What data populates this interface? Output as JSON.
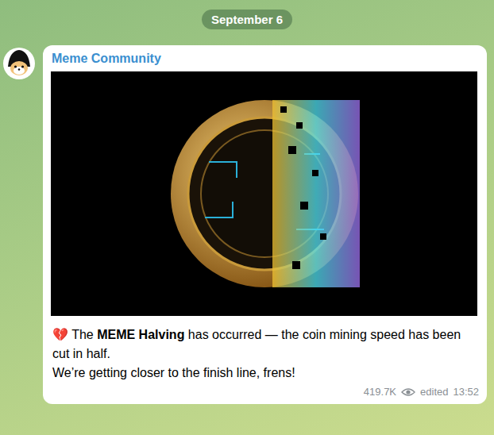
{
  "date": "September 6",
  "post": {
    "channel": "Meme Community",
    "paragraphs": [
      [
        {
          "text": "💔 The ",
          "bold": false
        },
        {
          "text": "MEME Halving",
          "bold": true
        },
        {
          "text": " has occurred — the coin mining speed has been cut in half.",
          "bold": false
        }
      ],
      [
        {
          "text": "We’re getting closer to the finish line, frens!",
          "bold": false
        }
      ]
    ],
    "views": "419.7K",
    "edited": "edited",
    "time": "13:52"
  }
}
